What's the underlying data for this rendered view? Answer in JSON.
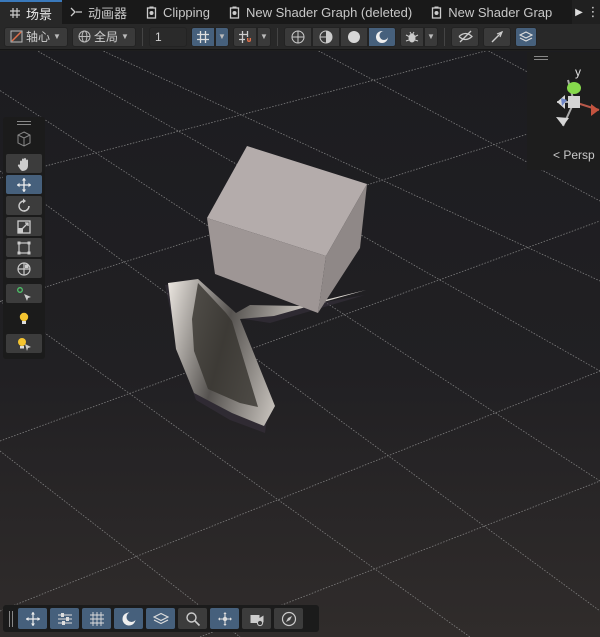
{
  "tabs": [
    {
      "label": "场景",
      "icon": "grid-icon",
      "active": true
    },
    {
      "label": "动画器",
      "icon": "animator-icon",
      "active": false
    },
    {
      "label": "Clipping",
      "icon": "shader-icon",
      "active": false
    },
    {
      "label": "New Shader Graph (deleted)",
      "icon": "shader-icon",
      "active": false
    },
    {
      "label": "New Shader Grap",
      "icon": "shader-icon",
      "active": false
    }
  ],
  "toolbar": {
    "pivot_label": "轴心",
    "space_label": "全局",
    "grid_size_value": "1"
  },
  "gizmo": {
    "y_axis_label": "y",
    "projection_label": "Persp"
  },
  "colors": {
    "accent": "#46607c",
    "tab_highlight": "#3a79bb",
    "cube_face_front": "#b4acab",
    "cube_face_side": "#948d8c"
  }
}
